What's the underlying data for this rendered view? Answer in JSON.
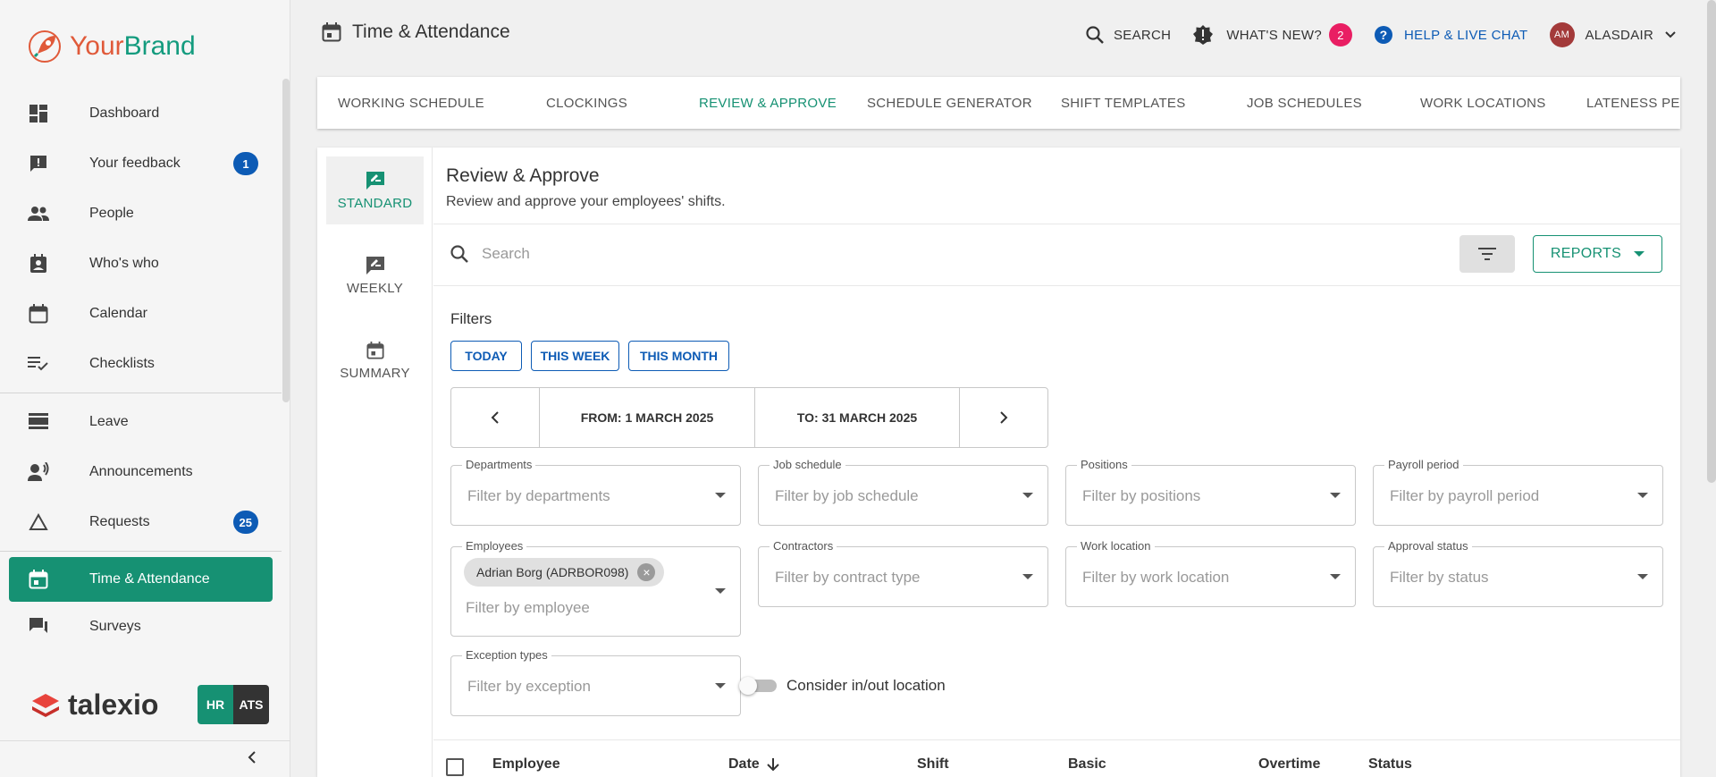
{
  "brand": {
    "name_a": "Your",
    "name_b": "Brand",
    "footer_logo": "talexio"
  },
  "sidebar": {
    "items": [
      {
        "label": "Dashboard",
        "icon": "dashboard-icon"
      },
      {
        "label": "Your feedback",
        "icon": "feedback-icon",
        "badge": "1"
      },
      {
        "label": "People",
        "icon": "people-icon"
      },
      {
        "label": "Who's who",
        "icon": "contact-icon"
      },
      {
        "label": "Calendar",
        "icon": "calendar-icon"
      },
      {
        "label": "Checklists",
        "icon": "checklist-icon"
      },
      {
        "label": "Leave",
        "icon": "leave-icon"
      },
      {
        "label": "Announcements",
        "icon": "announcement-icon"
      },
      {
        "label": "Requests",
        "icon": "requests-icon",
        "badge": "25"
      },
      {
        "label": "Time & Attendance",
        "icon": "calendar-icon",
        "active": true
      },
      {
        "label": "Surveys",
        "icon": "surveys-icon"
      }
    ],
    "switch_hr": "HR",
    "switch_ats": "ATS"
  },
  "header": {
    "title": "Time & Attendance",
    "search_label": "SEARCH",
    "whats_new_label": "WHAT'S NEW?",
    "whats_new_count": "2",
    "help_label": "HELP & LIVE CHAT",
    "user_initials": "AM",
    "user_name": "ALASDAIR"
  },
  "tabs": [
    "WORKING SCHEDULE",
    "CLOCKINGS",
    "REVIEW & APPROVE",
    "SCHEDULE GENERATOR",
    "SHIFT TEMPLATES",
    "JOB SCHEDULES",
    "WORK LOCATIONS",
    "LATENESS PENALTIES"
  ],
  "active_tab": "REVIEW & APPROVE",
  "vtabs": [
    "STANDARD",
    "WEEKLY",
    "SUMMARY"
  ],
  "main": {
    "title": "Review & Approve",
    "subtitle": "Review and approve your employees' shifts.",
    "search_placeholder": "Search",
    "reports_label": "REPORTS",
    "filters_label": "Filters",
    "quick": [
      "TODAY",
      "THIS WEEK",
      "THIS MONTH"
    ],
    "from": "FROM: 1 MARCH 2025",
    "to": "TO: 31 MARCH 2025",
    "fields": {
      "departments": {
        "label": "Departments",
        "placeholder": "Filter by departments"
      },
      "job_schedule": {
        "label": "Job schedule",
        "placeholder": "Filter by job schedule"
      },
      "positions": {
        "label": "Positions",
        "placeholder": "Filter by positions"
      },
      "payroll": {
        "label": "Payroll period",
        "placeholder": "Filter by payroll period"
      },
      "employees": {
        "label": "Employees",
        "placeholder": "Filter by employee",
        "chip": "Adrian Borg (ADRBOR098)"
      },
      "contractors": {
        "label": "Contractors",
        "placeholder": "Filter by contract type"
      },
      "work_location": {
        "label": "Work location",
        "placeholder": "Filter by work location"
      },
      "approval": {
        "label": "Approval status",
        "placeholder": "Filter by status"
      },
      "exception": {
        "label": "Exception types",
        "placeholder": "Filter by exception"
      }
    },
    "toggle_label": "Consider in/out location",
    "table_headers": [
      "Employee",
      "Date",
      "Shift",
      "Basic",
      "Overtime",
      "Status"
    ]
  }
}
